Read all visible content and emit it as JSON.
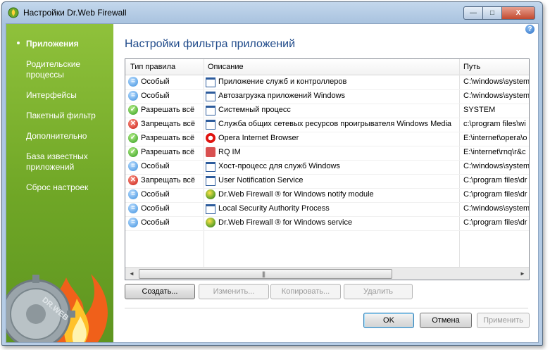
{
  "window": {
    "title": "Настройки Dr.Web Firewall",
    "minimize_label": "—",
    "maximize_label": "□",
    "close_label": "X"
  },
  "sidebar": {
    "items": [
      {
        "label": "Приложения",
        "active": true
      },
      {
        "label": "Родительские процессы"
      },
      {
        "label": "Интерфейсы"
      },
      {
        "label": "Пакетный фильтр"
      },
      {
        "label": "Дополнительно"
      },
      {
        "label": "База известных приложений"
      },
      {
        "label": "Сброс настроек"
      }
    ],
    "logo_text": "DR.WEB"
  },
  "help_label": "?",
  "heading": "Настройки фильтра приложений",
  "table": {
    "columns": [
      "Тип правила",
      "Описание",
      "Путь"
    ],
    "rows": [
      {
        "rule": "Особый",
        "rule_icon": "custom",
        "desc": "Приложение служб и контроллеров",
        "app_icon": "window",
        "path": "C:\\windows\\system"
      },
      {
        "rule": "Особый",
        "rule_icon": "custom",
        "desc": "Автозагрузка приложений Windows",
        "app_icon": "window",
        "path": "C:\\windows\\system"
      },
      {
        "rule": "Разрешать всё",
        "rule_icon": "allow",
        "desc": "Системный процесс",
        "app_icon": "window",
        "path": "SYSTEM"
      },
      {
        "rule": "Запрещать всё",
        "rule_icon": "deny",
        "desc": "Служба общих сетевых ресурсов проигрывателя Windows Media",
        "app_icon": "window",
        "path": "c:\\program files\\wi"
      },
      {
        "rule": "Разрешать всё",
        "rule_icon": "allow",
        "desc": "Opera Internet Browser",
        "app_icon": "opera",
        "path": "E:\\internet\\opera\\o"
      },
      {
        "rule": "Разрешать всё",
        "rule_icon": "allow",
        "desc": "RQ IM",
        "app_icon": "rq",
        "path": "E:\\internet\\rnq\\r&c"
      },
      {
        "rule": "Особый",
        "rule_icon": "custom",
        "desc": "Хост-процесс для служб Windows",
        "app_icon": "window",
        "path": "C:\\windows\\system"
      },
      {
        "rule": "Запрещать всё",
        "rule_icon": "deny",
        "desc": "User Notification Service",
        "app_icon": "window",
        "path": "C:\\program files\\dr"
      },
      {
        "rule": "Особый",
        "rule_icon": "custom",
        "desc": "Dr.Web Firewall ® for Windows notify module",
        "app_icon": "drweb",
        "path": "C:\\program files\\dr"
      },
      {
        "rule": "Особый",
        "rule_icon": "custom",
        "desc": "Local Security Authority Process",
        "app_icon": "window",
        "path": "C:\\windows\\system"
      },
      {
        "rule": "Особый",
        "rule_icon": "custom",
        "desc": "Dr.Web Firewall ® for Windows service",
        "app_icon": "drweb",
        "path": "C:\\program files\\dr"
      }
    ]
  },
  "scroll": {
    "left_arrow": "◄",
    "right_arrow": "►",
    "grip": "|||"
  },
  "actions": {
    "create": "Создать...",
    "edit": "Изменить...",
    "copy": "Копировать...",
    "delete": "Удалить"
  },
  "footer": {
    "ok": "OK",
    "cancel": "Отмена",
    "apply": "Применить"
  },
  "colors": {
    "sidebar_green": "#7cb32e",
    "heading_blue": "#1f4a8a"
  }
}
